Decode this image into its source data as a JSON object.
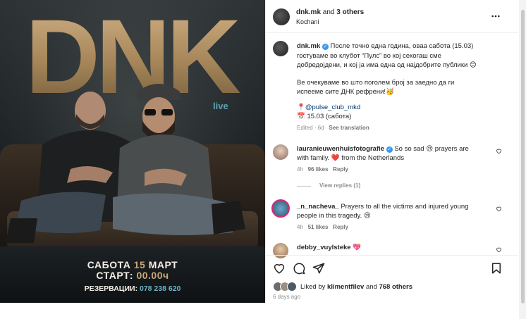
{
  "post": {
    "poster": {
      "brand": "DNK",
      "live": "live",
      "date_prefix": "САБОТА ",
      "date_day": "15",
      "date_suffix": " МАРТ",
      "start_prefix": "СТАРТ: ",
      "start_time": "00.00",
      "start_suffix": "ч",
      "reservation_label": "РЕЗЕРВАЦИИ: ",
      "reservation_phone": "078 238 620"
    },
    "header": {
      "username": "dnk.mk",
      "and_text": " and ",
      "others": "3 others",
      "location": "Kochani",
      "more_icon": "more-horizontal-icon"
    },
    "caption": {
      "username": "dnk.mk",
      "line1": "После точно една година, оваа сабота (15.03)",
      "line2": "гостуваме во клубот “Пулс” во кој секогаш сме",
      "line3": "добредојдени, и кој ја има една од најдобрите публики 😊",
      "line4": "Ве очекуваме во што поголем број за заедно да ги",
      "line5": "испееме сите ДНК рефрени!🥳",
      "mention": "📍@pulse_club_mkd",
      "date_line": "📅 15.03 (сабота)",
      "meta_edited": "Edited · 6d",
      "see_translation": "See translation"
    },
    "comments": [
      {
        "username": "lauranieuwenhuisfotografie",
        "text_line1": " So so sad 😢 prayers are",
        "text_line2": "with family. ❤️ from the Netherlands",
        "time": "4h",
        "likes": "96 likes",
        "reply": "Reply",
        "view_replies": "View replies (1)"
      },
      {
        "username": "_n_nacheva_",
        "text_line1": " Prayers to all the victims and injured young",
        "text_line2": "people in this tragedy. 😢",
        "time": "4h",
        "likes": "51 likes",
        "reply": "Reply"
      },
      {
        "username": "debby_vuylsteke",
        "text_line1": " 💖"
      }
    ],
    "actions": {
      "icons": [
        "heart-icon",
        "comment-icon",
        "share-icon",
        "bookmark-icon"
      ]
    },
    "likes": {
      "prefix": "Liked by ",
      "user": "klimentfilev",
      "middle": " and ",
      "count": "768 others"
    },
    "timestamp": "6 days ago"
  },
  "colors": {
    "verified": "#3897f0",
    "accent_gold": "#c8a877",
    "accent_teal": "#6cb3c4",
    "heart_red": "#ed4956",
    "text": "#262626",
    "muted": "#8e8e8e"
  }
}
